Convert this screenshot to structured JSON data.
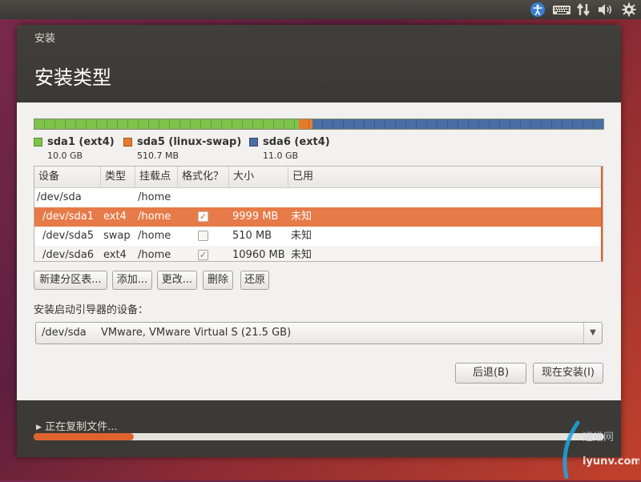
{
  "panel": {
    "indicators": [
      {
        "name": "accessibility-icon",
        "glyph": "♿"
      },
      {
        "name": "keyboard-icon",
        "glyph": "⌨"
      },
      {
        "name": "network-icon",
        "glyph": "⇅"
      },
      {
        "name": "volume-icon",
        "glyph": "🔊"
      },
      {
        "name": "gear-icon",
        "glyph": "⚙"
      }
    ]
  },
  "window": {
    "title": "安装",
    "page_title": "安装类型"
  },
  "partition_bar": {
    "segments": [
      {
        "name": "sda1",
        "color": "#7ec34b",
        "fraction": 0.4651
      },
      {
        "name": "sda5",
        "color": "#e67a2b",
        "fraction": 0.0238
      },
      {
        "name": "sda6",
        "color": "#4a6fa5",
        "fraction": 0.5111
      }
    ]
  },
  "legend": [
    {
      "name": "sda1 (ext4)",
      "size": "10.0 GB",
      "color": "#7ec34b"
    },
    {
      "name": "sda5 (linux-swap)",
      "size": "510.7 MB",
      "color": "#e67a2b"
    },
    {
      "name": "sda6 (ext4)",
      "size": "11.0 GB",
      "color": "#4a6fa5"
    }
  ],
  "table": {
    "headers": [
      "设备",
      "类型",
      "挂载点",
      "格式化？",
      "大小",
      "已用"
    ],
    "rows": [
      {
        "device": "/dev/sda",
        "type": "",
        "mount": "/home",
        "format": null,
        "size": "",
        "used": ""
      },
      {
        "device": "/dev/sda1",
        "type": "ext4",
        "mount": "/home",
        "format": "✓",
        "size": "9999 MB",
        "used": "未知"
      },
      {
        "device": "/dev/sda5",
        "type": "swap",
        "mount": "/home",
        "format": "",
        "size": "510 MB",
        "used": "未知"
      },
      {
        "device": "/dev/sda6",
        "type": "ext4",
        "mount": "/home",
        "format": "✓",
        "size": "10960 MB",
        "used": "未知"
      }
    ]
  },
  "actions": {
    "new_table": "新建分区表...",
    "add": "添加...",
    "change": "更改...",
    "delete": "删除",
    "revert": "还原"
  },
  "bootloader": {
    "label": "安装启动引导器的设备：",
    "device": "/dev/sda",
    "description": "VMware, VMware Virtual S (21.5 GB)"
  },
  "nav": {
    "back": "后退(B)",
    "install_now": "现在安装(I)"
  },
  "progress": {
    "text": "正在复制文件...",
    "fraction": 0.175
  },
  "watermark": {
    "text": "运维网",
    "url": "iyunv.com"
  }
}
